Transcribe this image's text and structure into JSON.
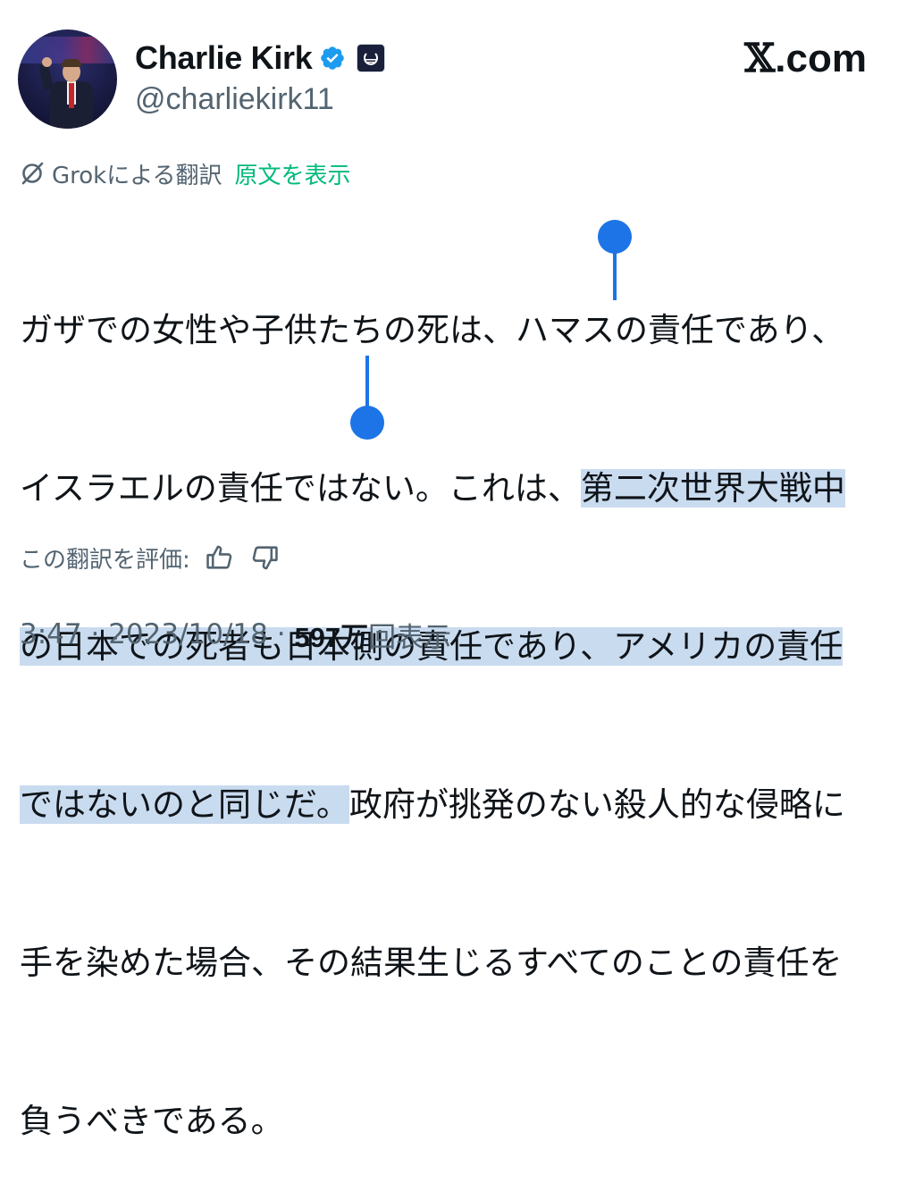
{
  "author": {
    "name": "Charlie Kirk",
    "handle": "@charliekirk11",
    "verified_color": "#1d9bf0"
  },
  "brand": {
    "x_label": "𝕏",
    "suffix": ".com"
  },
  "translation": {
    "grok_label": "Grokによる翻訳",
    "show_original": "原文を表示",
    "accent_color": "#00ba7c"
  },
  "tweet": {
    "lines": [
      {
        "before": "ガザでの女性や子供たちの死は、ハマスの責任であり、",
        "highlight": "",
        "after": ""
      },
      {
        "before": "イスラエルの責任ではない。これは、",
        "highlight": "第二次世界大戦中",
        "after": ""
      },
      {
        "before": "",
        "highlight": "の日本での死者も日本側の責任であり、アメリカの責任",
        "after": ""
      },
      {
        "before": "",
        "highlight": "ではないのと同じだ。",
        "after": "政府が挑発のない殺人的な侵略に"
      },
      {
        "before": "手を染めた場合、その結果生じるすべてのことの責任を",
        "highlight": "",
        "after": ""
      },
      {
        "before": "負うべきである。",
        "highlight": "",
        "after": ""
      }
    ]
  },
  "rating": {
    "label": "この翻訳を評価:",
    "thumbs_up": "thumbs-up-icon",
    "thumbs_down": "thumbs-down-icon"
  },
  "meta": {
    "time": "3:47",
    "sep1": " · ",
    "date": "2023/10/18",
    "sep2": " · ",
    "views_number": "597万",
    "views_suffix": "回表示"
  }
}
